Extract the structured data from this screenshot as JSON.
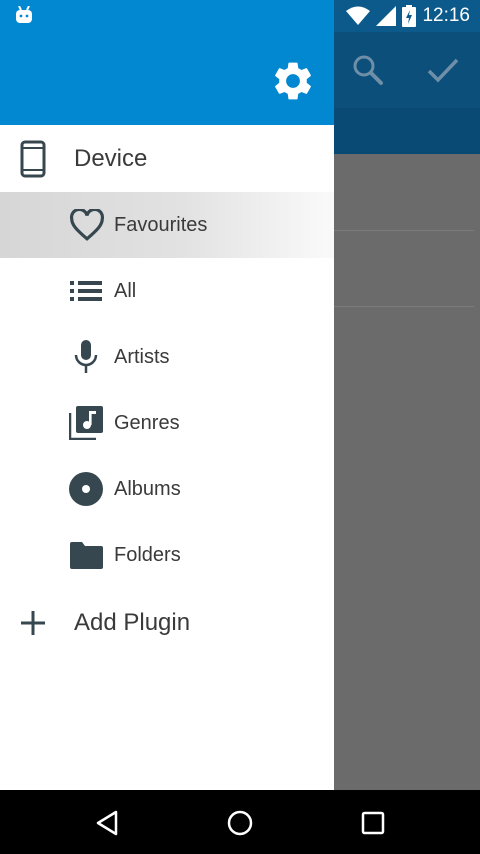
{
  "status": {
    "time": "12:16"
  },
  "drawer": {
    "device_label": "Device",
    "items": [
      {
        "label": "Favourites",
        "icon": "heart-icon",
        "selected": true
      },
      {
        "label": "All",
        "icon": "list-icon"
      },
      {
        "label": "Artists",
        "icon": "microphone-icon"
      },
      {
        "label": "Genres",
        "icon": "music-library-icon"
      },
      {
        "label": "Albums",
        "icon": "album-icon"
      },
      {
        "label": "Folders",
        "icon": "folder-icon"
      }
    ],
    "add_plugin_label": "Add Plugin"
  },
  "colors": {
    "drawer_header": "#0288d1",
    "toolbar": "#0c4f7a",
    "scrim": "#6b6b6b",
    "icon": "#37474f"
  }
}
